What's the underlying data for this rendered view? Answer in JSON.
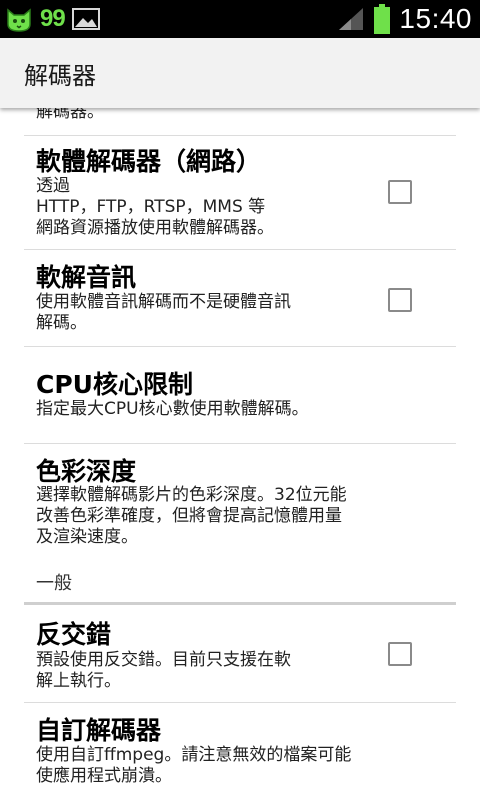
{
  "status_bar": {
    "battery_level": "99",
    "time": "15:40",
    "icons": [
      "cat-notification-icon",
      "image-notification-icon",
      "signal-icon",
      "battery-icon"
    ],
    "accent_color": "#6fe04a"
  },
  "action_bar": {
    "title": "解碼器"
  },
  "settings": {
    "partial_text": "解碼器。",
    "software_decoder_network": {
      "title": "軟體解碼器（網路）",
      "summary": "透過\nHTTP，FTP，RTSP，MMS 等\n網路資源播放使用軟體解碼器。",
      "checked": false
    },
    "soft_audio": {
      "title": "軟解音訊",
      "summary": "使用軟體音訊解碼而不是硬體音訊\n解碼。",
      "checked": false
    },
    "cpu_limit": {
      "title": "CPU核心限制",
      "summary": "指定最大CPU核心數使用軟體解碼。"
    },
    "color_depth": {
      "title": "色彩深度",
      "summary": "選擇軟體解碼影片的色彩深度。32位元能\n改善色彩準確度，但將會提高記憶體用量\n及渲染速度。"
    },
    "general_header": "一般",
    "deinterlace": {
      "title": "反交錯",
      "summary": "預設使用反交錯。目前只支援在軟\n解上執行。",
      "checked": false
    },
    "custom_codec": {
      "title": "自訂解碼器",
      "summary": "使用自訂ffmpeg。請注意無效的檔案可能\n使應用程式崩潰。"
    }
  }
}
